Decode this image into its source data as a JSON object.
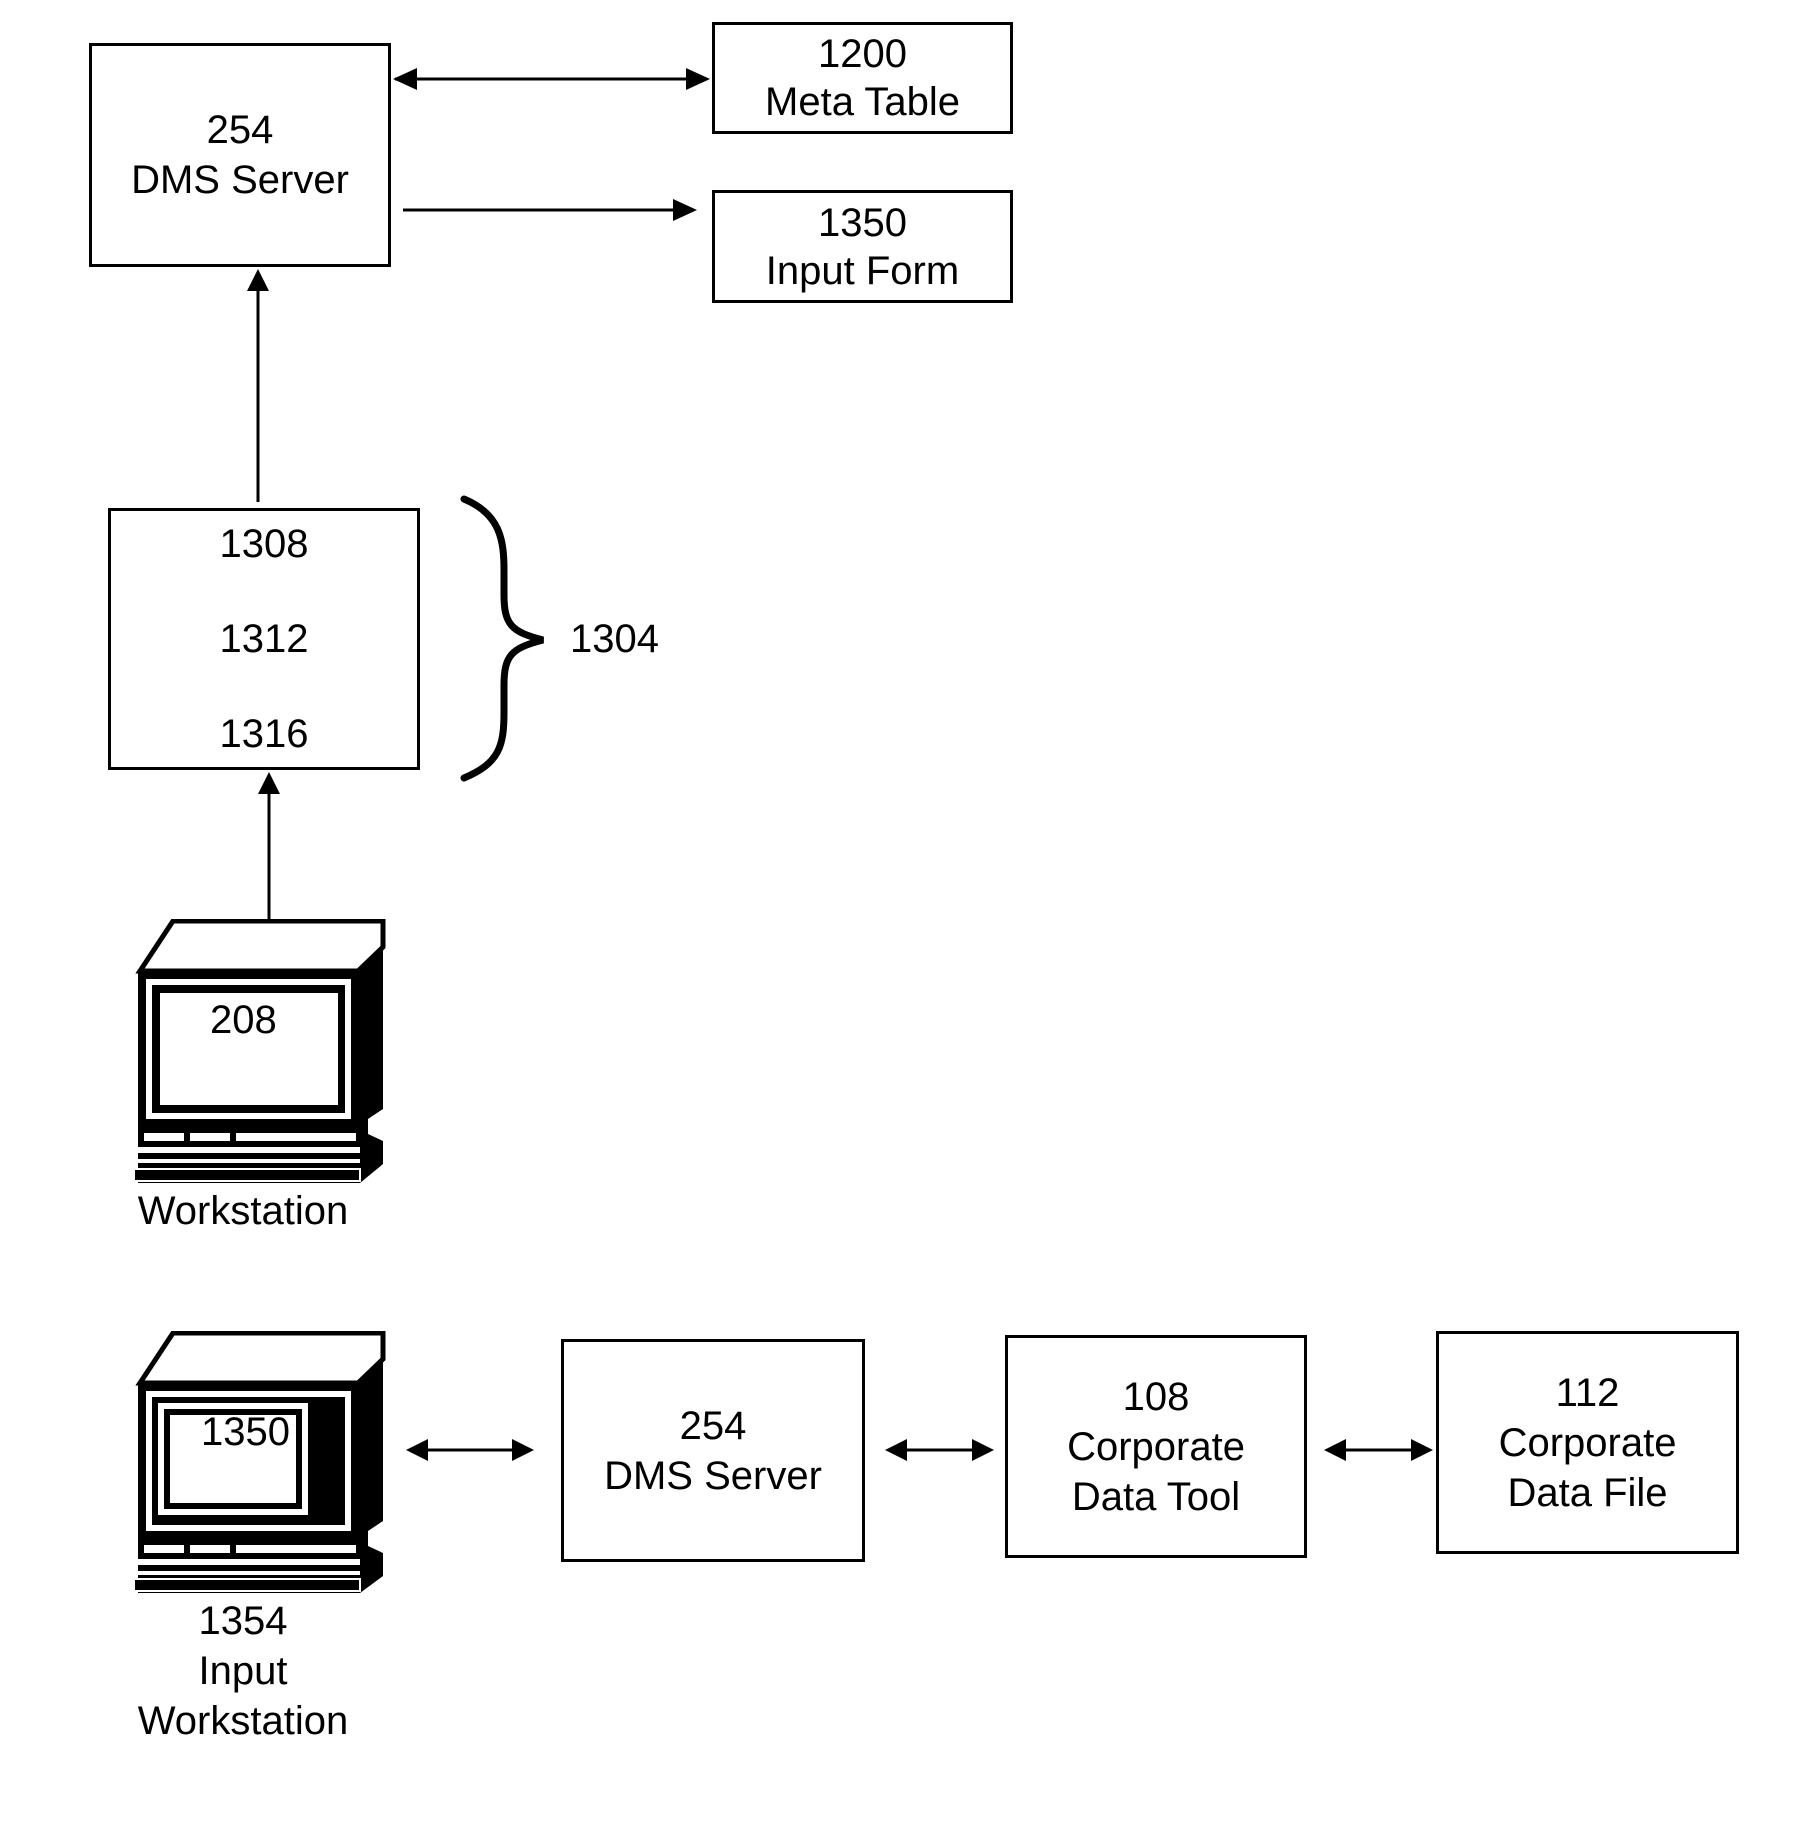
{
  "diagram": {
    "top_dms_server": {
      "number": "254",
      "name": "DMS Server"
    },
    "meta_table": {
      "number": "1200",
      "name": "Meta Table"
    },
    "input_form": {
      "number": "1350",
      "name": "Input Form"
    },
    "component_group": {
      "items": [
        "1308",
        "1312",
        "1316"
      ],
      "brace_label": "1304"
    },
    "workstation": {
      "screen_label": "208",
      "name": "Workstation"
    },
    "input_workstation": {
      "screen_label": "1350",
      "number": "1354",
      "name_line1": "Input",
      "name_line2": "Workstation"
    },
    "bottom_dms_server": {
      "number": "254",
      "name": "DMS Server"
    },
    "corporate_data_tool": {
      "number": "108",
      "name_line1": "Corporate",
      "name_line2": "Data Tool"
    },
    "corporate_data_file": {
      "number": "112",
      "name_line1": "Corporate",
      "name_line2": "Data File"
    }
  }
}
